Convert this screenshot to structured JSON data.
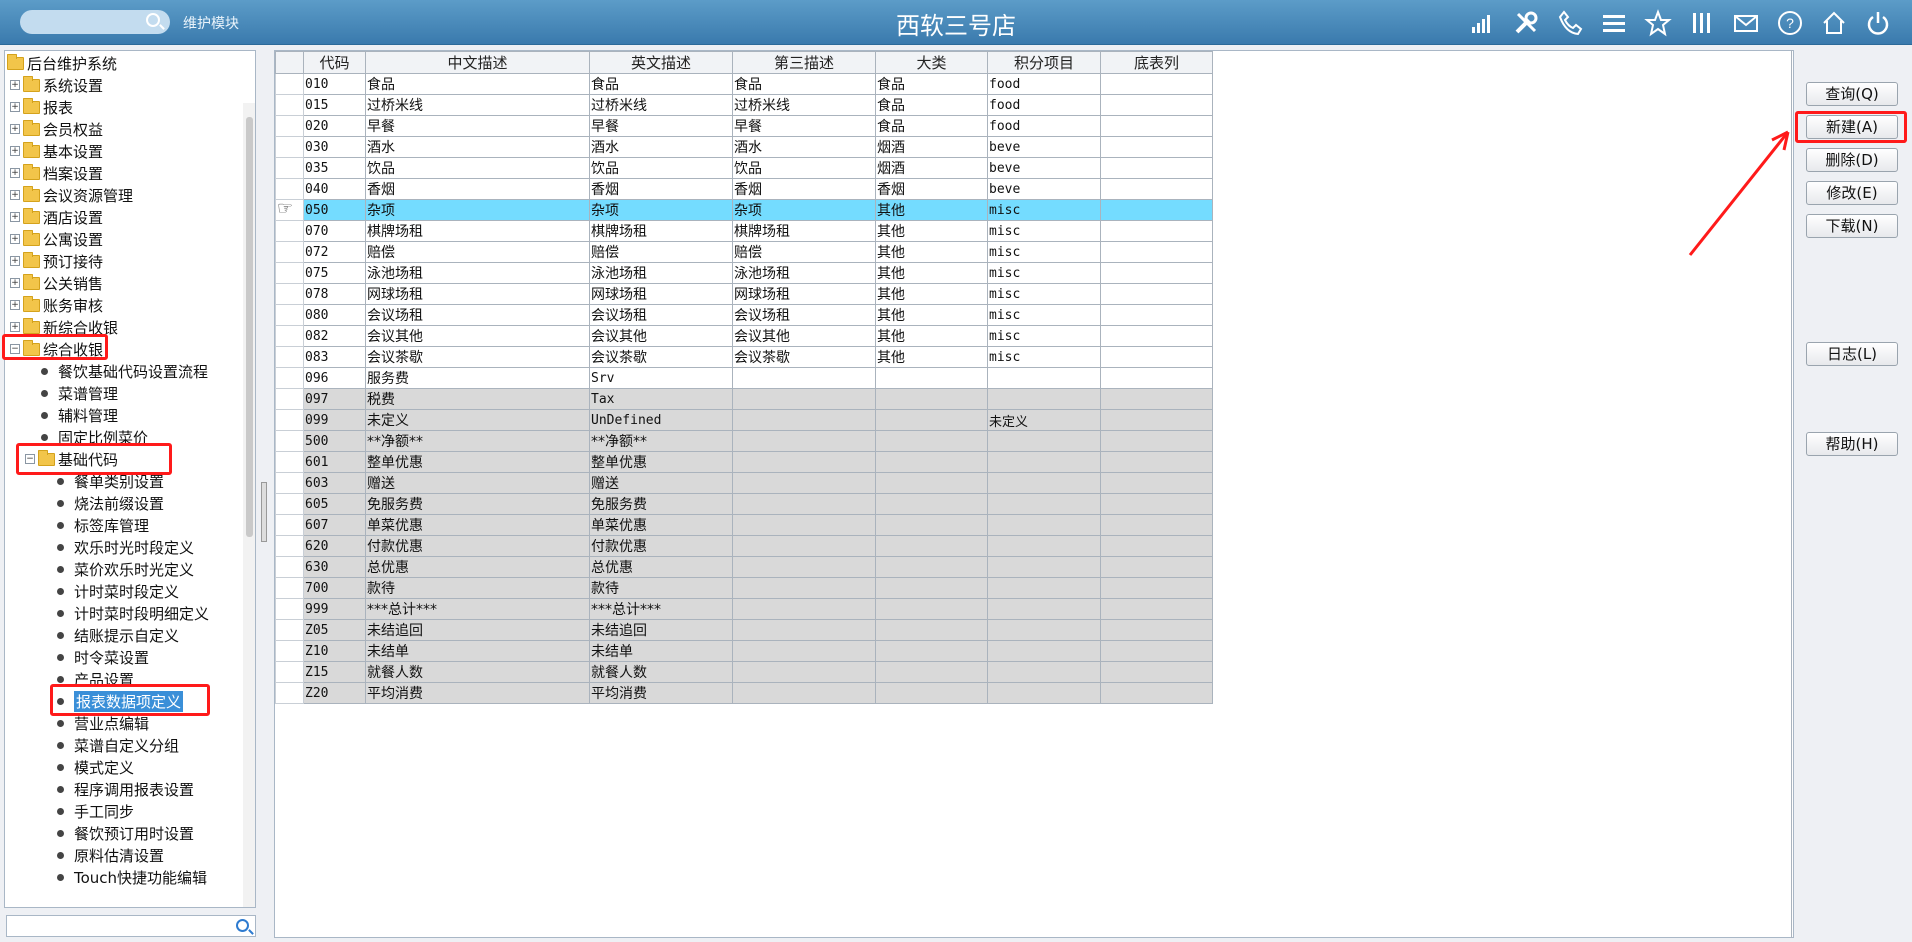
{
  "header": {
    "module": "维护模块",
    "store": "西软三号店",
    "icons": [
      "signal-icon",
      "tools-icon",
      "phone-icon",
      "menu-icon",
      "star-icon",
      "columns-icon",
      "mail-icon",
      "help-icon",
      "home-icon",
      "power-icon"
    ]
  },
  "tree": {
    "root": "后台维护系统",
    "groups": [
      "系统设置",
      "报表",
      "会员权益",
      "基本设置",
      "档案设置",
      "会议资源管理",
      "酒店设置",
      "公寓设置",
      "预订接待",
      "公关销售",
      "账务审核",
      "新综合收银",
      "综合收银"
    ],
    "pos_children": [
      "餐饮基础代码设置流程",
      "菜谱管理",
      "辅料管理",
      "固定比例菜价"
    ],
    "base_code": "基础代码",
    "base_children": [
      "餐单类别设置",
      "烧法前缀设置",
      "标签库管理",
      "欢乐时光时段定义",
      "菜价欢乐时光定义",
      "计时菜时段定义",
      "计时菜时段明细定义",
      "结账提示自定义",
      "时令菜设置",
      "产品设置",
      "报表数据项定义",
      "营业点编辑",
      "菜谱自定义分组",
      "模式定义",
      "程序调用报表设置",
      "手工同步",
      "餐饮预订用时设置",
      "原料估清设置",
      "Touch快捷功能编辑"
    ]
  },
  "grid": {
    "columns": [
      "代码",
      "中文描述",
      "英文描述",
      "第三描述",
      "大类",
      "积分项目",
      "底表列"
    ],
    "rows": [
      [
        "010",
        "食品",
        "食品",
        "食品",
        "食品",
        "food",
        ""
      ],
      [
        "015",
        "过桥米线",
        "过桥米线",
        "过桥米线",
        "食品",
        "food",
        ""
      ],
      [
        "020",
        "早餐",
        "早餐",
        "早餐",
        "食品",
        "food",
        ""
      ],
      [
        "030",
        "酒水",
        "酒水",
        "酒水",
        "烟酒",
        "beve",
        ""
      ],
      [
        "035",
        "饮品",
        "饮品",
        "饮品",
        "烟酒",
        "beve",
        ""
      ],
      [
        "040",
        "香烟",
        "香烟",
        "香烟",
        "香烟",
        "beve",
        ""
      ],
      [
        "050",
        "杂项",
        "杂项",
        "杂项",
        "其他",
        "misc",
        ""
      ],
      [
        "070",
        "棋牌场租",
        "棋牌场租",
        "棋牌场租",
        "其他",
        "misc",
        ""
      ],
      [
        "072",
        "赔偿",
        "赔偿",
        "赔偿",
        "其他",
        "misc",
        ""
      ],
      [
        "075",
        "泳池场租",
        "泳池场租",
        "泳池场租",
        "其他",
        "misc",
        ""
      ],
      [
        "078",
        "网球场租",
        "网球场租",
        "网球场租",
        "其他",
        "misc",
        ""
      ],
      [
        "080",
        "会议场租",
        "会议场租",
        "会议场租",
        "其他",
        "misc",
        ""
      ],
      [
        "082",
        "会议其他",
        "会议其他",
        "会议其他",
        "其他",
        "misc",
        ""
      ],
      [
        "083",
        "会议茶歇",
        "会议茶歇",
        "会议茶歇",
        "其他",
        "misc",
        ""
      ],
      [
        "096",
        "服务费",
        "Srv",
        "",
        "",
        "",
        ""
      ],
      [
        "097",
        "税费",
        "Tax",
        "",
        "",
        "",
        ""
      ],
      [
        "099",
        "未定义",
        "UnDefined",
        "",
        "",
        "未定义",
        ""
      ],
      [
        "500",
        "**净额**",
        "**净额**",
        "",
        "",
        "",
        ""
      ],
      [
        "601",
        "整单优惠",
        "整单优惠",
        "",
        "",
        "",
        ""
      ],
      [
        "603",
        "赠送",
        "赠送",
        "",
        "",
        "",
        ""
      ],
      [
        "605",
        "免服务费",
        "免服务费",
        "",
        "",
        "",
        ""
      ],
      [
        "607",
        "单菜优惠",
        "单菜优惠",
        "",
        "",
        "",
        ""
      ],
      [
        "620",
        "付款优惠",
        "付款优惠",
        "",
        "",
        "",
        ""
      ],
      [
        "630",
        "总优惠",
        "总优惠",
        "",
        "",
        "",
        ""
      ],
      [
        "700",
        "款待",
        "款待",
        "",
        "",
        "",
        ""
      ],
      [
        "999",
        "***总计***",
        "***总计***",
        "",
        "",
        "",
        ""
      ],
      [
        "Z05",
        "未结追回",
        "未结追回",
        "",
        "",
        "",
        ""
      ],
      [
        "Z10",
        "未结单",
        "未结单",
        "",
        "",
        "",
        ""
      ],
      [
        "Z15",
        "就餐人数",
        "就餐人数",
        "",
        "",
        "",
        ""
      ],
      [
        "Z20",
        "平均消费",
        "平均消费",
        "",
        "",
        "",
        ""
      ]
    ]
  },
  "buttons": {
    "query": "查询(Q)",
    "new": "新建(A)",
    "delete": "删除(D)",
    "modify": "修改(E)",
    "download": "下载(N)",
    "log": "日志(L)",
    "help": "帮助(H)"
  },
  "colors": {
    "header": "#3a7aad",
    "selected_row": "#74dcff",
    "highlight": "#ff1a1a",
    "gray_row": "#d9d9d9"
  }
}
